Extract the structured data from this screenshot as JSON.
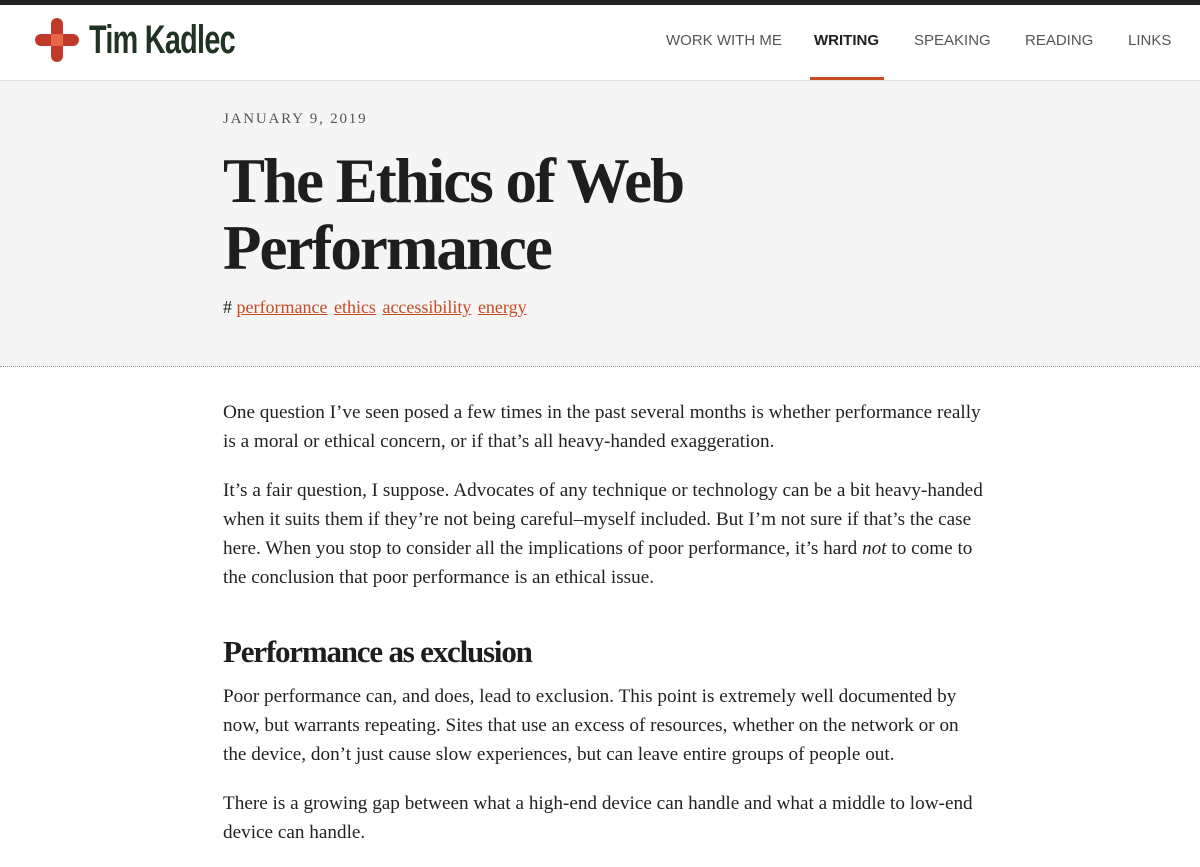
{
  "site": {
    "name": "Tim Kadlec",
    "accent": "#c74a22",
    "logo_color": "#d2533c"
  },
  "nav": {
    "items": [
      {
        "label": "WORK WITH ME",
        "active": false
      },
      {
        "label": "WRITING",
        "active": true
      },
      {
        "label": "SPEAKING",
        "active": false
      },
      {
        "label": "READING",
        "active": false
      },
      {
        "label": "LINKS",
        "active": false
      }
    ]
  },
  "post": {
    "date": "JANUARY 9, 2019",
    "title": "The Ethics of Web Performance",
    "tag_prefix": "#",
    "tags": [
      "performance",
      "ethics",
      "accessibility",
      "energy"
    ],
    "paragraphs": [
      "One question I’ve seen posed a few times in the past several months is whether performance really is a moral or ethical concern, or if that’s all heavy-handed exaggeration.",
      {
        "before": "It’s a fair question, I suppose. Advocates of any technique or technology can be a bit heavy-handed when it suits them if they’re not being careful–myself included. But I’m not sure if that’s the case here. When you stop to consider all the implications of poor performance, it’s hard ",
        "em": "not",
        "after": " to come to the conclusion that poor performance is an ethical issue."
      }
    ],
    "section_heading": "Performance as exclusion",
    "section_paragraphs": [
      "Poor performance can, and does, lead to exclusion. This point is extremely well documented by now, but warrants repeating. Sites that use an excess of resources, whether on the network or on the device, don’t just cause slow experiences, but can leave entire groups of people out.",
      "There is a growing gap between what a high-end device can handle and what a middle to low-end device can handle."
    ]
  }
}
